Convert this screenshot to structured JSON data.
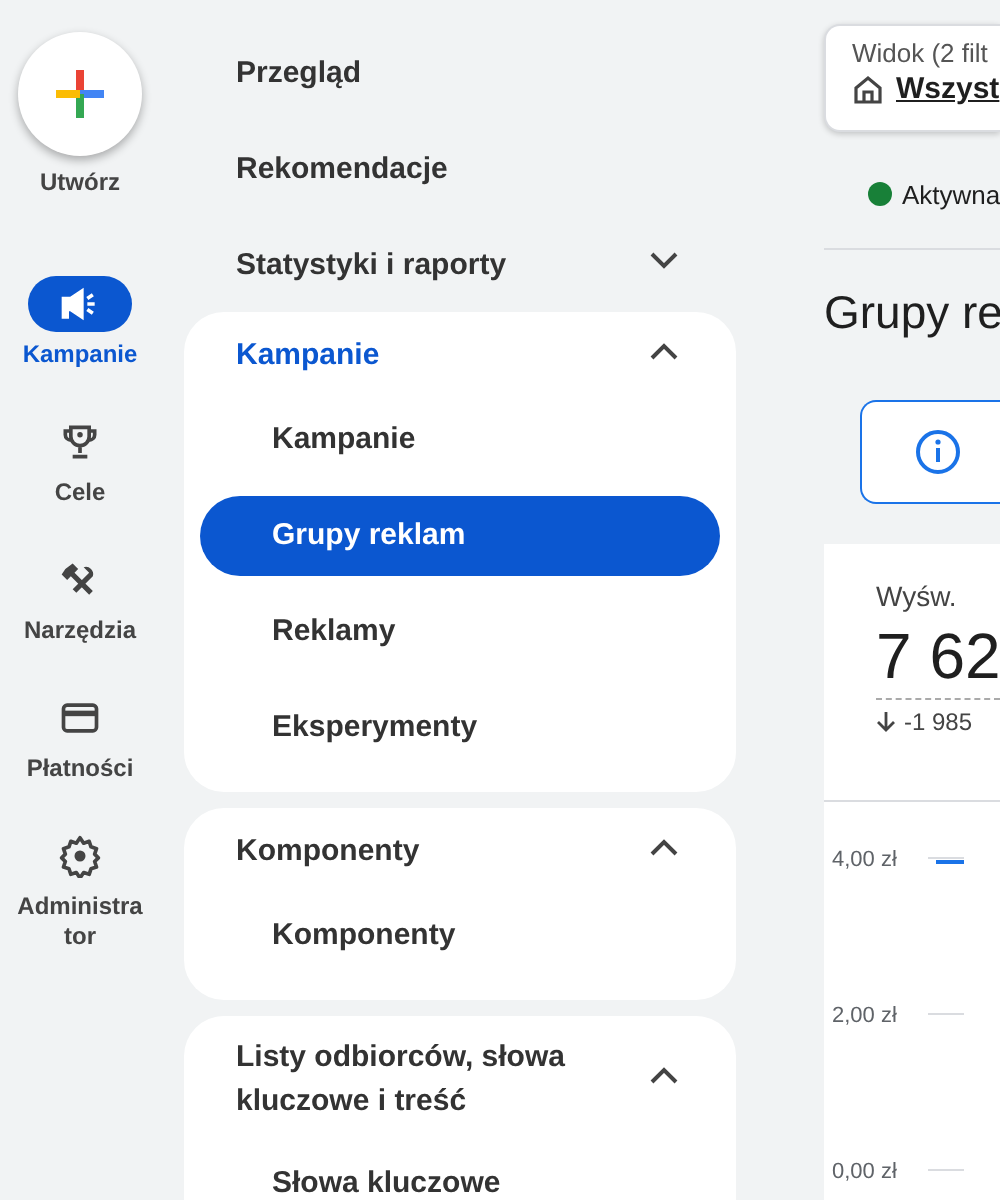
{
  "rail": {
    "create": {
      "label": "Utwórz"
    },
    "items": [
      {
        "kind": "megaphone",
        "label": "Kampanie",
        "selected": true
      },
      {
        "kind": "trophy",
        "label": "Cele",
        "selected": false
      },
      {
        "kind": "tools",
        "label": "Narzędzia",
        "selected": false
      },
      {
        "kind": "card",
        "label": "Płatności",
        "selected": false
      },
      {
        "kind": "gear",
        "label": "Administrator",
        "selected": false
      }
    ]
  },
  "nav": {
    "items": [
      {
        "kind": "link",
        "label": "Przegląd"
      },
      {
        "kind": "link",
        "label": "Rekomendacje"
      },
      {
        "kind": "group",
        "label": "Statystyki i raporty",
        "expanded": false
      }
    ],
    "sections": [
      {
        "label": "Kampanie",
        "active": true,
        "expanded": true,
        "children": [
          {
            "label": "Kampanie",
            "selected": false
          },
          {
            "label": "Grupy reklam",
            "selected": true
          },
          {
            "label": "Reklamy",
            "selected": false
          },
          {
            "label": "Eksperymenty",
            "selected": false
          }
        ]
      },
      {
        "label": "Komponenty",
        "active": false,
        "expanded": true,
        "children": [
          {
            "label": "Komponenty",
            "selected": false
          }
        ]
      },
      {
        "label": "Listy odbiorców, słowa kluczowe i treść",
        "active": false,
        "expanded": true,
        "children": [
          {
            "label": "Słowa kluczowe",
            "selected": false
          }
        ]
      }
    ]
  },
  "main": {
    "view": {
      "label": "Widok (2 filt",
      "value": "Wszyst"
    },
    "status": {
      "label": "Aktywna",
      "color": "#188038"
    },
    "title": "Grupy re",
    "metric": {
      "label": "Wyśw.",
      "value": "7 62",
      "change": "-1 985"
    },
    "chart": {
      "axis_labels": [
        "4,00 zł",
        "2,00 zł",
        "0,00 zł"
      ]
    }
  }
}
